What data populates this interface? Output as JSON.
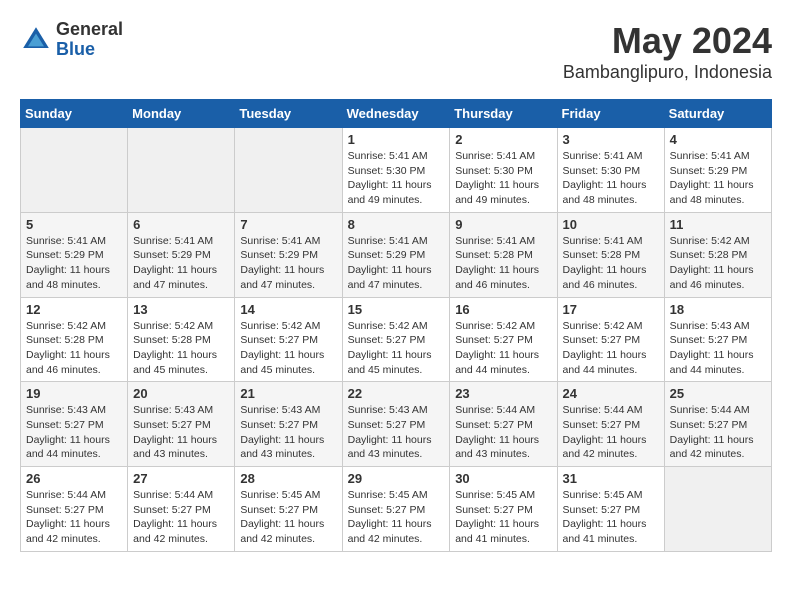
{
  "logo": {
    "general": "General",
    "blue": "Blue"
  },
  "title": {
    "month_year": "May 2024",
    "location": "Bambanglipuro, Indonesia"
  },
  "weekdays": [
    "Sunday",
    "Monday",
    "Tuesday",
    "Wednesday",
    "Thursday",
    "Friday",
    "Saturday"
  ],
  "weeks": [
    [
      {
        "day": "",
        "info": ""
      },
      {
        "day": "",
        "info": ""
      },
      {
        "day": "",
        "info": ""
      },
      {
        "day": "1",
        "info": "Sunrise: 5:41 AM\nSunset: 5:30 PM\nDaylight: 11 hours\nand 49 minutes."
      },
      {
        "day": "2",
        "info": "Sunrise: 5:41 AM\nSunset: 5:30 PM\nDaylight: 11 hours\nand 49 minutes."
      },
      {
        "day": "3",
        "info": "Sunrise: 5:41 AM\nSunset: 5:30 PM\nDaylight: 11 hours\nand 48 minutes."
      },
      {
        "day": "4",
        "info": "Sunrise: 5:41 AM\nSunset: 5:29 PM\nDaylight: 11 hours\nand 48 minutes."
      }
    ],
    [
      {
        "day": "5",
        "info": "Sunrise: 5:41 AM\nSunset: 5:29 PM\nDaylight: 11 hours\nand 48 minutes."
      },
      {
        "day": "6",
        "info": "Sunrise: 5:41 AM\nSunset: 5:29 PM\nDaylight: 11 hours\nand 47 minutes."
      },
      {
        "day": "7",
        "info": "Sunrise: 5:41 AM\nSunset: 5:29 PM\nDaylight: 11 hours\nand 47 minutes."
      },
      {
        "day": "8",
        "info": "Sunrise: 5:41 AM\nSunset: 5:29 PM\nDaylight: 11 hours\nand 47 minutes."
      },
      {
        "day": "9",
        "info": "Sunrise: 5:41 AM\nSunset: 5:28 PM\nDaylight: 11 hours\nand 46 minutes."
      },
      {
        "day": "10",
        "info": "Sunrise: 5:41 AM\nSunset: 5:28 PM\nDaylight: 11 hours\nand 46 minutes."
      },
      {
        "day": "11",
        "info": "Sunrise: 5:42 AM\nSunset: 5:28 PM\nDaylight: 11 hours\nand 46 minutes."
      }
    ],
    [
      {
        "day": "12",
        "info": "Sunrise: 5:42 AM\nSunset: 5:28 PM\nDaylight: 11 hours\nand 46 minutes."
      },
      {
        "day": "13",
        "info": "Sunrise: 5:42 AM\nSunset: 5:28 PM\nDaylight: 11 hours\nand 45 minutes."
      },
      {
        "day": "14",
        "info": "Sunrise: 5:42 AM\nSunset: 5:27 PM\nDaylight: 11 hours\nand 45 minutes."
      },
      {
        "day": "15",
        "info": "Sunrise: 5:42 AM\nSunset: 5:27 PM\nDaylight: 11 hours\nand 45 minutes."
      },
      {
        "day": "16",
        "info": "Sunrise: 5:42 AM\nSunset: 5:27 PM\nDaylight: 11 hours\nand 44 minutes."
      },
      {
        "day": "17",
        "info": "Sunrise: 5:42 AM\nSunset: 5:27 PM\nDaylight: 11 hours\nand 44 minutes."
      },
      {
        "day": "18",
        "info": "Sunrise: 5:43 AM\nSunset: 5:27 PM\nDaylight: 11 hours\nand 44 minutes."
      }
    ],
    [
      {
        "day": "19",
        "info": "Sunrise: 5:43 AM\nSunset: 5:27 PM\nDaylight: 11 hours\nand 44 minutes."
      },
      {
        "day": "20",
        "info": "Sunrise: 5:43 AM\nSunset: 5:27 PM\nDaylight: 11 hours\nand 43 minutes."
      },
      {
        "day": "21",
        "info": "Sunrise: 5:43 AM\nSunset: 5:27 PM\nDaylight: 11 hours\nand 43 minutes."
      },
      {
        "day": "22",
        "info": "Sunrise: 5:43 AM\nSunset: 5:27 PM\nDaylight: 11 hours\nand 43 minutes."
      },
      {
        "day": "23",
        "info": "Sunrise: 5:44 AM\nSunset: 5:27 PM\nDaylight: 11 hours\nand 43 minutes."
      },
      {
        "day": "24",
        "info": "Sunrise: 5:44 AM\nSunset: 5:27 PM\nDaylight: 11 hours\nand 42 minutes."
      },
      {
        "day": "25",
        "info": "Sunrise: 5:44 AM\nSunset: 5:27 PM\nDaylight: 11 hours\nand 42 minutes."
      }
    ],
    [
      {
        "day": "26",
        "info": "Sunrise: 5:44 AM\nSunset: 5:27 PM\nDaylight: 11 hours\nand 42 minutes."
      },
      {
        "day": "27",
        "info": "Sunrise: 5:44 AM\nSunset: 5:27 PM\nDaylight: 11 hours\nand 42 minutes."
      },
      {
        "day": "28",
        "info": "Sunrise: 5:45 AM\nSunset: 5:27 PM\nDaylight: 11 hours\nand 42 minutes."
      },
      {
        "day": "29",
        "info": "Sunrise: 5:45 AM\nSunset: 5:27 PM\nDaylight: 11 hours\nand 42 minutes."
      },
      {
        "day": "30",
        "info": "Sunrise: 5:45 AM\nSunset: 5:27 PM\nDaylight: 11 hours\nand 41 minutes."
      },
      {
        "day": "31",
        "info": "Sunrise: 5:45 AM\nSunset: 5:27 PM\nDaylight: 11 hours\nand 41 minutes."
      },
      {
        "day": "",
        "info": ""
      }
    ]
  ]
}
